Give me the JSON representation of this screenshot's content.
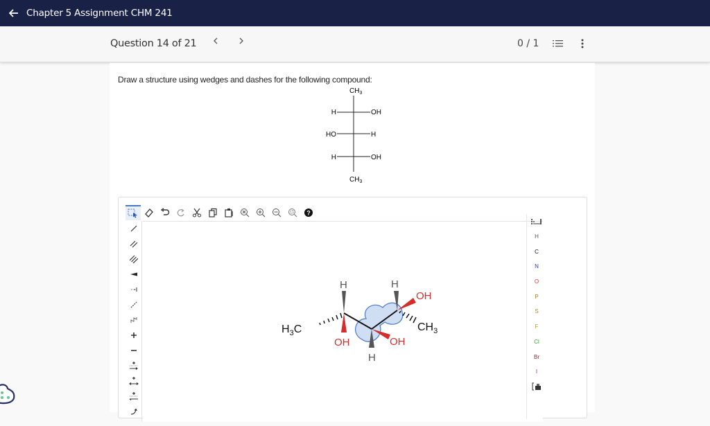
{
  "header": {
    "back_icon": "arrow-left-icon",
    "title": "Chapter 5 Assignment CHM 241"
  },
  "question_bar": {
    "label": "Question 14 of 21",
    "prev_label": "<",
    "next_label": ">",
    "score": "0 / 1",
    "list_icon": "numbered-list-icon",
    "more_icon": "more-vertical-icon"
  },
  "question": {
    "prompt": "Draw a structure using wedges and dashes for the following compound:",
    "fischer": {
      "top": "CH3",
      "bottom": "CH3",
      "rows": [
        {
          "left": "H",
          "right": "OH"
        },
        {
          "left": "HO",
          "right": "H"
        },
        {
          "left": "H",
          "right": "OH"
        }
      ]
    }
  },
  "editor": {
    "top_tools": [
      {
        "name": "select-tool",
        "icon": "select-icon",
        "active": true
      },
      {
        "name": "erase-tool",
        "icon": "eraser-icon"
      },
      {
        "name": "undo-tool",
        "icon": "undo-icon"
      },
      {
        "name": "redo-tool",
        "icon": "redo-icon"
      },
      {
        "name": "cut-tool",
        "icon": "scissors-icon"
      },
      {
        "name": "copy-tool",
        "icon": "copy-icon"
      },
      {
        "name": "paste-tool",
        "icon": "paste-icon"
      },
      {
        "name": "zoom-reset-tool",
        "icon": "zoom-reset-icon"
      },
      {
        "name": "zoom-in-tool",
        "icon": "zoom-in-icon"
      },
      {
        "name": "zoom-out-tool",
        "icon": "zoom-out-icon"
      },
      {
        "name": "zoom-fit-tool",
        "icon": "zoom-fit-icon"
      },
      {
        "name": "help-tool",
        "icon": "help-icon"
      }
    ],
    "left_tools": [
      {
        "name": "single-bond-tool",
        "icon": "single-bond-icon"
      },
      {
        "name": "double-bond-tool",
        "icon": "double-bond-icon"
      },
      {
        "name": "triple-bond-tool",
        "icon": "triple-bond-icon"
      },
      {
        "name": "wedge-bond-tool",
        "icon": "wedge-bond-icon"
      },
      {
        "name": "dash-bond-tool",
        "icon": "dash-bond-icon"
      },
      {
        "name": "dashed-bond-tool",
        "icon": "dashed-bond-icon"
      },
      {
        "name": "chain-tool",
        "icon": "chain-icon"
      },
      {
        "name": "positive-charge-tool",
        "icon": "plus-icon",
        "glyph": "+"
      },
      {
        "name": "negative-charge-tool",
        "icon": "minus-icon",
        "glyph": "−"
      },
      {
        "name": "reaction-arrow-tool",
        "icon": "reaction-arrow-icon"
      },
      {
        "name": "equilibrium-arrow-tool",
        "icon": "equilibrium-arrow-icon"
      },
      {
        "name": "resonance-arrow-tool",
        "icon": "resonance-arrow-icon"
      },
      {
        "name": "curved-arrow-tool",
        "icon": "curved-arrow-icon"
      }
    ],
    "right_tools": [
      {
        "name": "periodic-table-button",
        "icon": "periodic-table-icon"
      },
      {
        "name": "element-H",
        "label": "H",
        "color": "#555555"
      },
      {
        "name": "element-C",
        "label": "C",
        "color": "#111111"
      },
      {
        "name": "element-N",
        "label": "N",
        "color": "#2b3a9c"
      },
      {
        "name": "element-O",
        "label": "O",
        "color": "#e03030"
      },
      {
        "name": "element-P",
        "label": "P",
        "color": "#b07a20"
      },
      {
        "name": "element-S",
        "label": "S",
        "color": "#a08a20"
      },
      {
        "name": "element-F",
        "label": "F",
        "color": "#c49040"
      },
      {
        "name": "element-Cl",
        "label": "Cl",
        "color": "#2fa02f"
      },
      {
        "name": "element-Br",
        "label": "Br",
        "color": "#7a2a2a"
      },
      {
        "name": "element-I",
        "label": "I",
        "color": "#7a2aa0"
      },
      {
        "name": "template-button",
        "icon": "template-icon"
      }
    ],
    "molecule": {
      "labels": {
        "h3c": "H3C",
        "c2_h": "H",
        "c2_oh": "OH",
        "c3_h": "H",
        "c3_oh": "OH",
        "c4_h": "H",
        "c4_oh": "OH",
        "ch3": "CH3"
      },
      "oxygen_color": "#e03030",
      "hydrogen_color": "#555555",
      "selection_color": "#4a78c8"
    }
  }
}
